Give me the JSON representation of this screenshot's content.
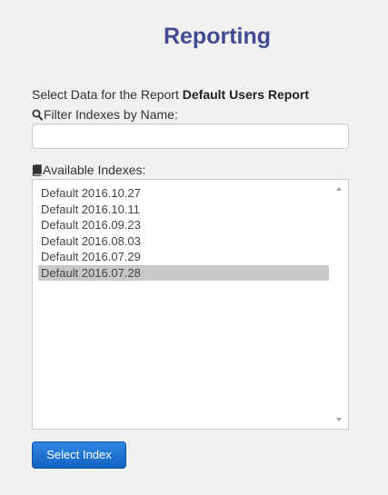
{
  "page": {
    "title": "Reporting"
  },
  "report": {
    "prefix": "Select Data for the Report",
    "name": "Default Users Report"
  },
  "filter": {
    "label": "Filter Indexes by Name:",
    "icon": "search-icon",
    "value": "",
    "placeholder": ""
  },
  "indexes": {
    "label": "Available Indexes:",
    "icon": "book-icon",
    "items": [
      {
        "label": "Default 2016.10.27",
        "selected": false
      },
      {
        "label": "Default 2016.10.11",
        "selected": false
      },
      {
        "label": "Default 2016.09.23",
        "selected": false
      },
      {
        "label": "Default 2016.08.03",
        "selected": false
      },
      {
        "label": "Default 2016.07.29",
        "selected": false
      },
      {
        "label": "Default 2016.07.28",
        "selected": true
      }
    ]
  },
  "actions": {
    "select_label": "Select Index"
  },
  "colors": {
    "title": "#414a93",
    "button": "#1a6fd0",
    "selected_row": "#c8c8c8",
    "background": "#f1f1f0"
  }
}
